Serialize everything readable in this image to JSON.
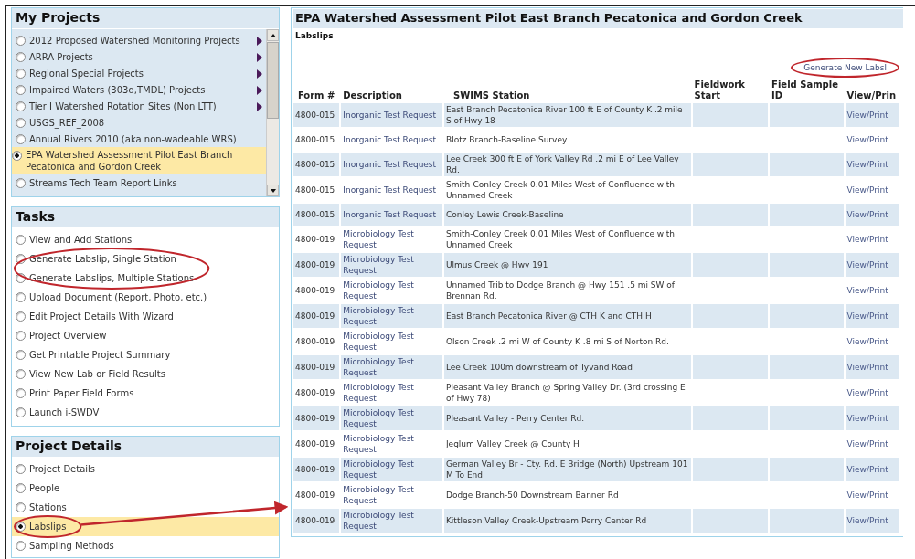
{
  "my_projects": {
    "title": "My Projects",
    "items": [
      {
        "label": "2012 Proposed Watershed Monitoring Projects",
        "selected": false,
        "has_submenu": true
      },
      {
        "label": "ARRA Projects",
        "selected": false,
        "has_submenu": true
      },
      {
        "label": "Regional Special Projects",
        "selected": false,
        "has_submenu": true
      },
      {
        "label": "Impaired Waters (303d,TMDL) Projects",
        "selected": false,
        "has_submenu": true
      },
      {
        "label": "Tier I Watershed Rotation Sites (Non LTT)",
        "selected": false,
        "has_submenu": true
      },
      {
        "label": "USGS_REF_2008",
        "selected": false,
        "has_submenu": false
      },
      {
        "label": "Annual Rivers 2010 (aka non-wadeable WRS)",
        "selected": false,
        "has_submenu": false
      },
      {
        "label": "EPA Watershed Assessment Pilot East Branch Pecatonica and Gordon Creek",
        "selected": true,
        "has_submenu": false
      },
      {
        "label": "Streams Tech Team Report Links",
        "selected": false,
        "has_submenu": false
      }
    ]
  },
  "tasks": {
    "title": "Tasks",
    "items": [
      {
        "label": "View and Add Stations",
        "selected": false
      },
      {
        "label": "Generate Labslip, Single Station",
        "selected": false,
        "circled": true
      },
      {
        "label": "Generate Labslips, Multiple Stations",
        "selected": false,
        "circled": true
      },
      {
        "label": "Upload Document (Report, Photo, etc.)",
        "selected": false
      },
      {
        "label": "Edit Project Details With Wizard",
        "selected": false
      },
      {
        "label": "Project Overview",
        "selected": false
      },
      {
        "label": "Get Printable Project Summary",
        "selected": false
      },
      {
        "label": "View New Lab or Field Results",
        "selected": false
      },
      {
        "label": "Print Paper Field Forms",
        "selected": false
      },
      {
        "label": "Launch i-SWDV",
        "selected": false
      }
    ]
  },
  "project_details": {
    "title": "Project Details",
    "items": [
      {
        "label": "Project Details",
        "selected": false
      },
      {
        "label": "People",
        "selected": false
      },
      {
        "label": "Stations",
        "selected": false
      },
      {
        "label": "Labslips",
        "selected": true,
        "circled": true
      },
      {
        "label": "Sampling Methods",
        "selected": false
      }
    ]
  },
  "main": {
    "title": "EPA Watershed Assessment Pilot East Branch Pecatonica and Gordon Creek",
    "subtitle": "Labslips",
    "generate_link": {
      "label": "Generate New Labsl",
      "circled": true
    },
    "table": {
      "columns": [
        "Form #",
        "Description",
        "SWIMS Station",
        "Fieldwork Start",
        "Field Sample ID",
        "View/Prin"
      ],
      "rows": [
        {
          "form": "4800-015",
          "description": "Inorganic Test Request",
          "station": "East Branch Pecatonica River 100 ft E of County K .2 mile S of Hwy 18",
          "action": "View/Print"
        },
        {
          "form": "4800-015",
          "description": "Inorganic Test Request",
          "station": "Blotz Branch-Baseline Survey",
          "action": "View/Print"
        },
        {
          "form": "4800-015",
          "description": "Inorganic Test Request",
          "station": "Lee Creek 300 ft E of York Valley Rd .2 mi E of Lee Valley Rd.",
          "action": "View/Print"
        },
        {
          "form": "4800-015",
          "description": "Inorganic Test Request",
          "station": "Smith-Conley Creek 0.01 Miles West of Confluence with Unnamed Creek",
          "action": "View/Print"
        },
        {
          "form": "4800-015",
          "description": "Inorganic Test Request",
          "station": "Conley Lewis Creek-Baseline",
          "action": "View/Print"
        },
        {
          "form": "4800-019",
          "description": "Microbiology Test Request",
          "station": "Smith-Conley Creek 0.01 Miles West of Confluence with Unnamed Creek",
          "action": "View/Print"
        },
        {
          "form": "4800-019",
          "description": "Microbiology Test Request",
          "station": "Ulmus Creek @ Hwy 191",
          "action": "View/Print"
        },
        {
          "form": "4800-019",
          "description": "Microbiology Test Request",
          "station": "Unnamed Trib to Dodge Branch @ Hwy 151 .5 mi SW of Brennan Rd.",
          "action": "View/Print"
        },
        {
          "form": "4800-019",
          "description": "Microbiology Test Request",
          "station": "East Branch Pecatonica River @ CTH K and CTH H",
          "action": "View/Print"
        },
        {
          "form": "4800-019",
          "description": "Microbiology Test Request",
          "station": "Olson Creek .2 mi W of County K .8 mi S of Norton Rd.",
          "action": "View/Print"
        },
        {
          "form": "4800-019",
          "description": "Microbiology Test Request",
          "station": "Lee Creek 100m downstream of Tyvand Road",
          "action": "View/Print"
        },
        {
          "form": "4800-019",
          "description": "Microbiology Test Request",
          "station": "Pleasant Valley Branch @ Spring Valley Dr. (3rd crossing E of Hwy 78)",
          "action": "View/Print"
        },
        {
          "form": "4800-019",
          "description": "Microbiology Test Request",
          "station": "Pleasant Valley - Perry Center Rd.",
          "action": "View/Print"
        },
        {
          "form": "4800-019",
          "description": "Microbiology Test Request",
          "station": "Jeglum Valley Creek @ County H",
          "action": "View/Print"
        },
        {
          "form": "4800-019",
          "description": "Microbiology Test Request",
          "station": "German Valley Br - Cty. Rd. E Bridge (North) Upstream 101 M To End",
          "action": "View/Print"
        },
        {
          "form": "4800-019",
          "description": "Microbiology Test Request",
          "station": "Dodge Branch-50 Downstream Banner Rd",
          "action": "View/Print"
        },
        {
          "form": "4800-019",
          "description": "Microbiology Test Request",
          "station": "Kittleson Valley Creek-Upstream Perry Center Rd",
          "action": "View/Print"
        }
      ]
    }
  }
}
